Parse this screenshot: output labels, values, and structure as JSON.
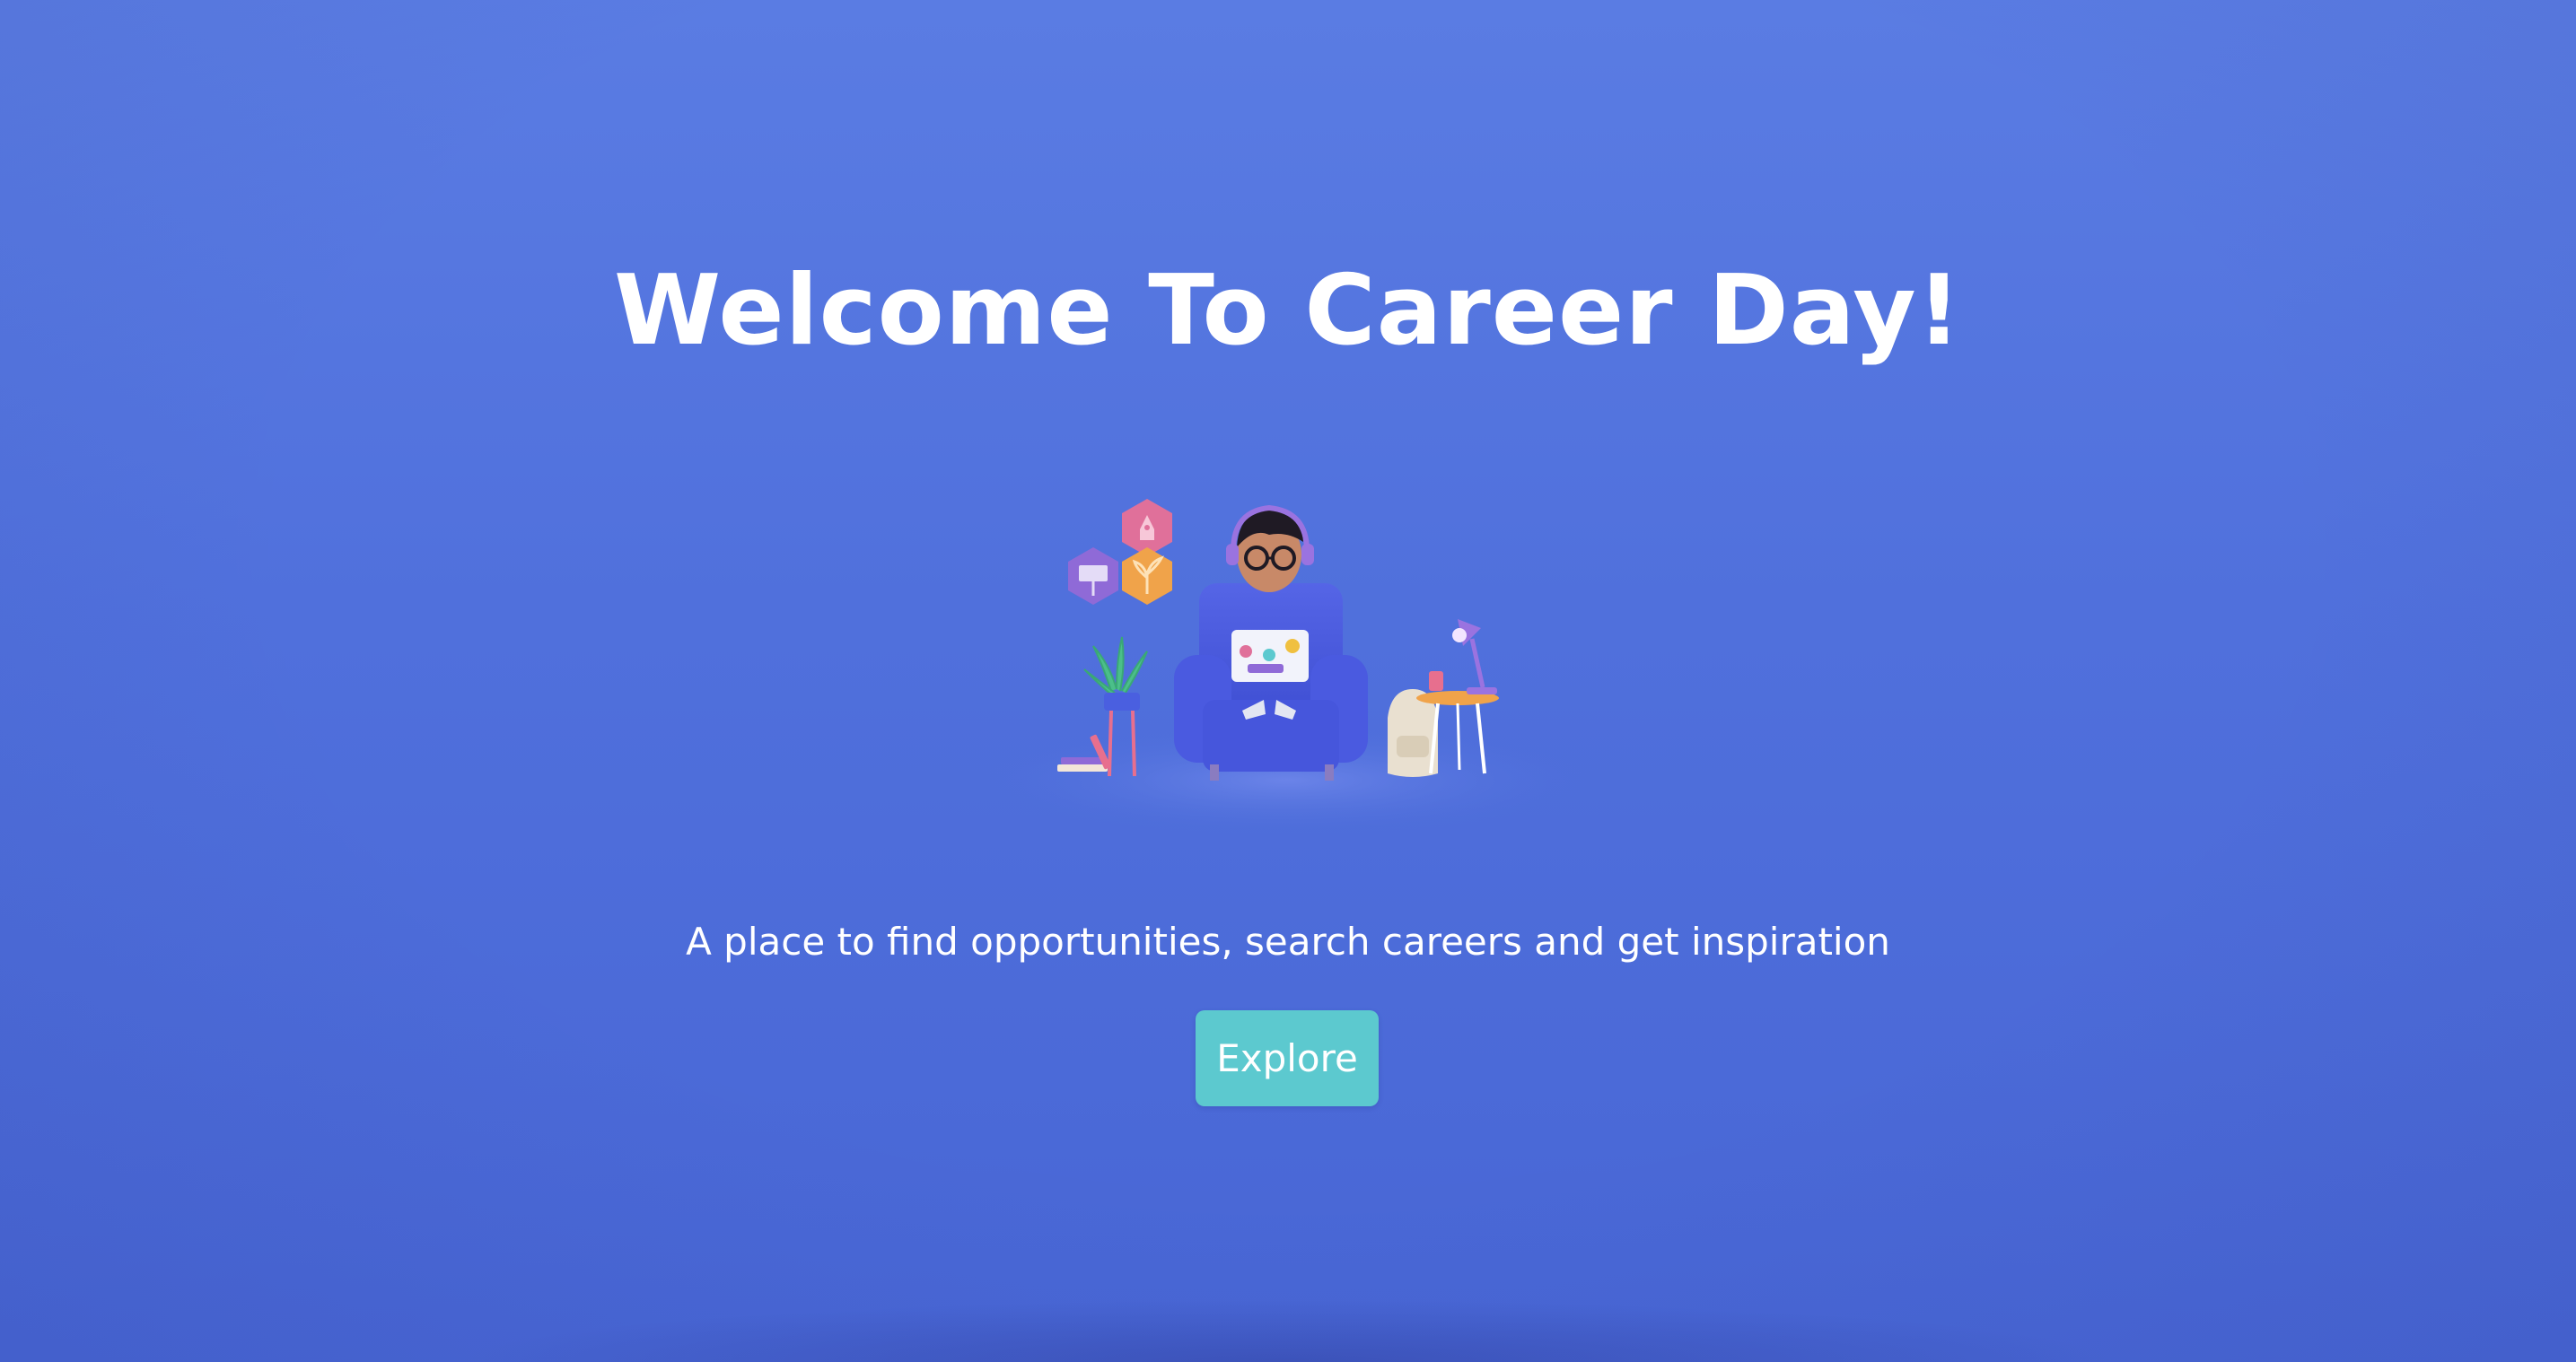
{
  "hero": {
    "title": "Welcome To Career Day!",
    "subtitle": "A place to find opportunities, search careers and get inspiration",
    "explore_label": "Explore"
  },
  "illustration": {
    "subject": "person-on-armchair-with-laptop",
    "badges": [
      "rocket-icon",
      "presentation-icon",
      "plant-icon"
    ]
  },
  "colors": {
    "background_top": "#5a7ce3",
    "background_bottom": "#4866d5",
    "button": "#5cc9cf",
    "text": "#ffffff"
  }
}
